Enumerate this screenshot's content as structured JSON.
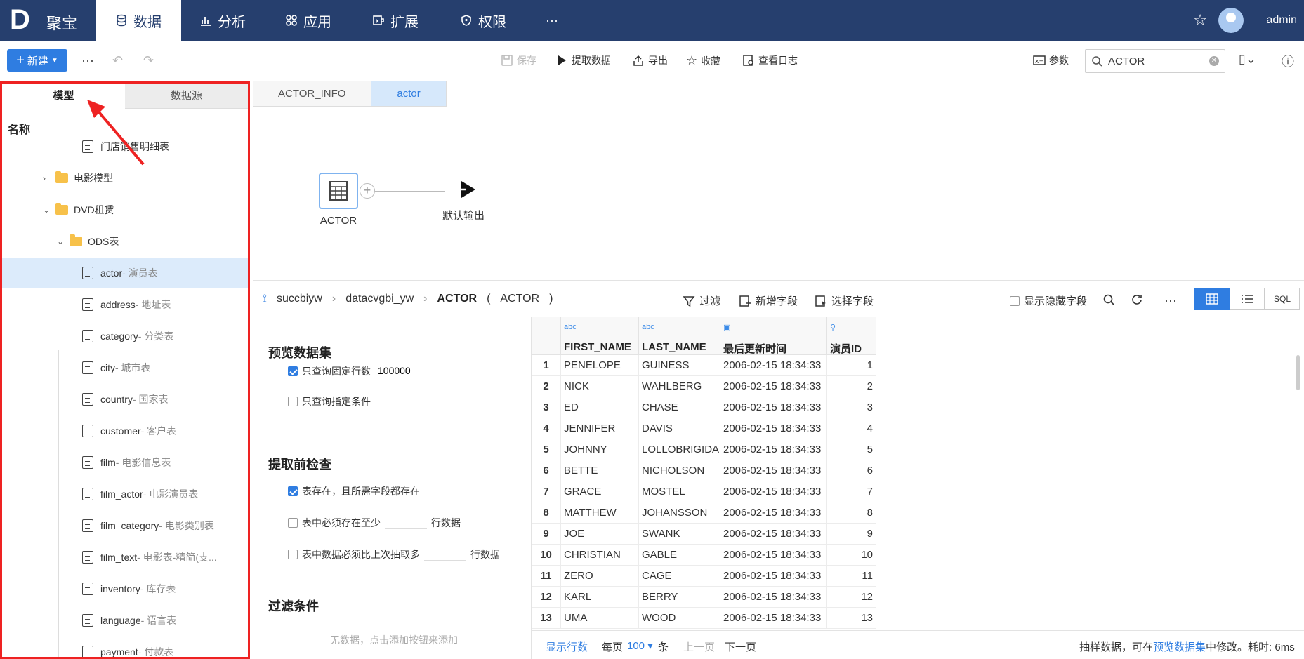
{
  "topnav": {
    "logo": "D",
    "brand": "聚宝",
    "tabs": [
      {
        "label": "数据",
        "icon": "database-icon"
      },
      {
        "label": "分析",
        "icon": "bar-chart-icon"
      },
      {
        "label": "应用",
        "icon": "grid-icon"
      },
      {
        "label": "扩展",
        "icon": "extend-icon"
      },
      {
        "label": "权限",
        "icon": "shield-icon"
      }
    ],
    "more": "···",
    "username": "admin"
  },
  "toolbar": {
    "new_label": "新建",
    "more": "···",
    "save": "保存",
    "extract": "提取数据",
    "export": "导出",
    "favorite": "收藏",
    "log": "查看日志",
    "params": "参数",
    "search_value": "ACTOR"
  },
  "leftpanel": {
    "tabs": [
      "模型",
      "数据源"
    ],
    "column_header": "名称",
    "tree": [
      {
        "name": "门店销售明细表",
        "sub": "",
        "type": "table",
        "depth": 2
      },
      {
        "name": "电影模型",
        "sub": "",
        "type": "folder",
        "chev": "›",
        "depth": 1
      },
      {
        "name": "DVD租赁",
        "sub": "",
        "type": "folder",
        "chev": "⌄",
        "depth": 1
      },
      {
        "name": "ODS表",
        "sub": "",
        "type": "folder",
        "chev": "⌄",
        "depth": 2
      },
      {
        "name": "actor",
        "sub": " - 演员表",
        "type": "table",
        "depth": 3,
        "selected": true
      },
      {
        "name": "address",
        "sub": " - 地址表",
        "type": "table",
        "depth": 3
      },
      {
        "name": "category",
        "sub": " - 分类表",
        "type": "table",
        "depth": 3
      },
      {
        "name": "city",
        "sub": " - 城市表",
        "type": "table",
        "depth": 3
      },
      {
        "name": "country",
        "sub": " - 国家表",
        "type": "table",
        "depth": 3
      },
      {
        "name": "customer",
        "sub": " - 客户表",
        "type": "table",
        "depth": 3
      },
      {
        "name": "film",
        "sub": " - 电影信息表",
        "type": "table",
        "depth": 3
      },
      {
        "name": "film_actor",
        "sub": " - 电影演员表",
        "type": "table",
        "depth": 3
      },
      {
        "name": "film_category",
        "sub": " - 电影类别表",
        "type": "table",
        "depth": 3
      },
      {
        "name": "film_text",
        "sub": " - 电影表-精简(支...",
        "type": "table",
        "depth": 3
      },
      {
        "name": "inventory",
        "sub": " - 库存表",
        "type": "table",
        "depth": 3
      },
      {
        "name": "language",
        "sub": " - 语言表",
        "type": "table",
        "depth": 3
      },
      {
        "name": "payment",
        "sub": " - 付款表",
        "type": "table",
        "depth": 3
      }
    ]
  },
  "doc_tabs": [
    "ACTOR_INFO",
    "actor"
  ],
  "flow": {
    "source_node": "ACTOR",
    "output_node": "默认输出"
  },
  "crumbs": {
    "items": [
      "succbiyw",
      "datacvgbi_yw"
    ],
    "current": "ACTOR",
    "alias": "ACTOR",
    "filter": "过滤",
    "add_field": "新增字段",
    "select_field": "选择字段",
    "show_hidden": "显示隐藏字段",
    "sql": "SQL"
  },
  "settings": {
    "preview_title": "预览数据集",
    "fixed_rows_label": "只查询固定行数",
    "fixed_rows_value": "100000",
    "condition_label": "只查询指定条件",
    "precheck_title": "提取前检查",
    "exists_label": "表存在，且所需字段都存在",
    "min_rows_label": "表中必须存在至少",
    "rows_suffix": "行数据",
    "more_rows_label": "表中数据必须比上次抽取多",
    "filter_title": "过滤条件",
    "empty_hint": "无数据，点击添加按钮来添加"
  },
  "grid": {
    "columns": [
      {
        "type": "abc",
        "name": "FIRST_NAME"
      },
      {
        "type": "abc",
        "name": "LAST_NAME"
      },
      {
        "type": "date",
        "name": "最后更新时间"
      },
      {
        "type": "key",
        "name": "演员ID"
      }
    ],
    "rows": [
      [
        "1",
        "PENELOPE",
        "GUINESS",
        "2006-02-15 18:34:33",
        "1"
      ],
      [
        "2",
        "NICK",
        "WAHLBERG",
        "2006-02-15 18:34:33",
        "2"
      ],
      [
        "3",
        "ED",
        "CHASE",
        "2006-02-15 18:34:33",
        "3"
      ],
      [
        "4",
        "JENNIFER",
        "DAVIS",
        "2006-02-15 18:34:33",
        "4"
      ],
      [
        "5",
        "JOHNNY",
        "LOLLOBRIGIDA",
        "2006-02-15 18:34:33",
        "5"
      ],
      [
        "6",
        "BETTE",
        "NICHOLSON",
        "2006-02-15 18:34:33",
        "6"
      ],
      [
        "7",
        "GRACE",
        "MOSTEL",
        "2006-02-15 18:34:33",
        "7"
      ],
      [
        "8",
        "MATTHEW",
        "JOHANSSON",
        "2006-02-15 18:34:33",
        "8"
      ],
      [
        "9",
        "JOE",
        "SWANK",
        "2006-02-15 18:34:33",
        "9"
      ],
      [
        "10",
        "CHRISTIAN",
        "GABLE",
        "2006-02-15 18:34:33",
        "10"
      ],
      [
        "11",
        "ZERO",
        "CAGE",
        "2006-02-15 18:34:33",
        "11"
      ],
      [
        "12",
        "KARL",
        "BERRY",
        "2006-02-15 18:34:33",
        "12"
      ],
      [
        "13",
        "UMA",
        "WOOD",
        "2006-02-15 18:34:33",
        "13"
      ]
    ]
  },
  "footer": {
    "show_rows": "显示行数",
    "per_page": "每页",
    "page_size": "100 ▾",
    "unit": "条",
    "prev": "上一页",
    "next": "下一页",
    "note_prefix": "抽样数据，可在",
    "note_link": "预览数据集",
    "note_suffix": "中修改。耗时: 6ms"
  },
  "colors": {
    "nav_bg": "#263f6e",
    "accent": "#2f7de1",
    "highlight_border": "#e22"
  }
}
